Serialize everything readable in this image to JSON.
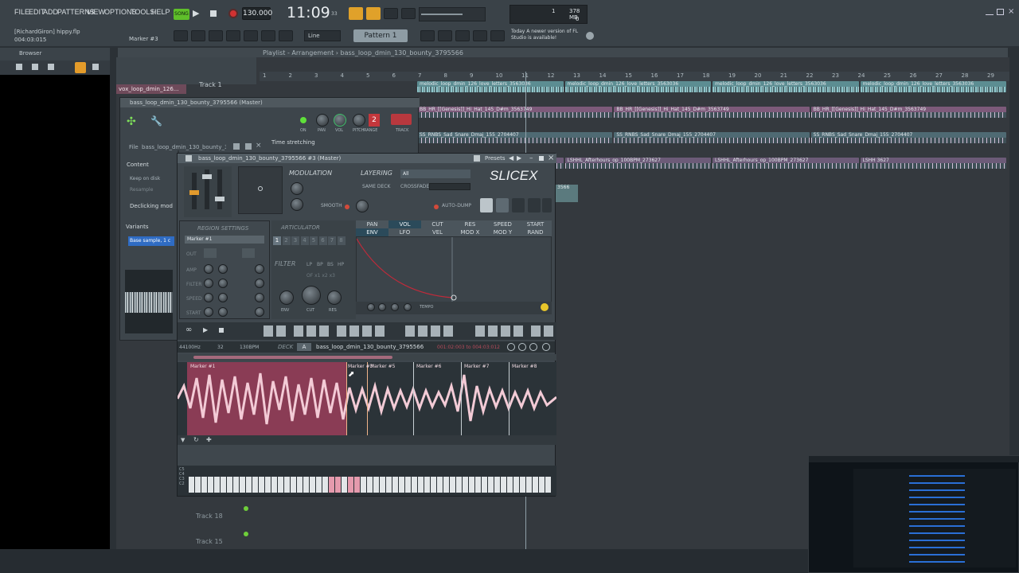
{
  "menu": [
    "FILE",
    "EDIT",
    "ADD",
    "PATTERNS",
    "VIEW",
    "OPTIONS",
    "TOOLS",
    "HELP"
  ],
  "transport": {
    "song_label": "SONG",
    "tempo": "130.000",
    "clock": "11:09",
    "clock_sub": "33",
    "cpu": "1",
    "memory": "378 MB",
    "poly": "0"
  },
  "project": {
    "user": "[RichardGiron] hippy.flp",
    "time": "004:03:015",
    "marker": "Marker #3"
  },
  "toolbar": {
    "snap": "Line",
    "pattern": "Pattern 1",
    "news": "Today  A newer version of FL Studio is available!"
  },
  "browser": {
    "label": "Browser"
  },
  "playlist": {
    "breadcrumb": "Playlist - Arrangement › bass_loop_dmin_130_bounty_3795566",
    "bar_numbers": [
      "1",
      "2",
      "3",
      "4",
      "5",
      "6",
      "7",
      "8",
      "9",
      "10",
      "11",
      "12",
      "13",
      "14",
      "15",
      "16",
      "17",
      "18",
      "19",
      "20",
      "21",
      "22",
      "23",
      "24",
      "25",
      "26",
      "27",
      "28",
      "29"
    ],
    "track_label": "Track 1",
    "pattern_tab": "vox_loop_dmin_126...",
    "rows": [
      {
        "clips": [
          "melodic_loop_dmin_126_love_letters_3563036",
          "melodic_loop_dmin_126_love_letters_3563036",
          "melodic_loop_dmin_126_love_letters_3563036",
          "melodic_loop_dmin_126_love_letters_3563036"
        ],
        "color": "#5c8d92",
        "wave": "wave"
      },
      {
        "clips": [
          "BB_HR_[[Genesis]]_Hi_Hat_145_D#m_3563749",
          "BB_HR_[[Genesis]]_Hi_Hat_145_D#m_3563749",
          "BB_HR_[[Genesis]]_Hi_Hat_145_D#m_3563749"
        ],
        "color": "#7d5a7a",
        "wave": "wave2"
      },
      {
        "clips": [
          "SS_RNBS_Sad_Snare_Dmaj_155_2704407",
          "SS_RNBS_Sad_Snare_Dmaj_155_2704407",
          "SS_RNBS_Sad_Snare_Dmaj_155_2704407"
        ],
        "color": "#4f6a73",
        "wave": "wave2"
      },
      {
        "clips": [
          "LSHHL_Afterhours_op_100BPM_273627",
          "LSHHL_Afterhours_op_100BPM_273627",
          "LSHHL_Afterhours_op_100BPM_273627",
          "LSHH 3627"
        ],
        "color": "#6c5b78",
        "wave": "wave2"
      }
    ],
    "small_clip": "3566",
    "bottom_tracks": [
      "Track 18",
      "Track 15"
    ]
  },
  "channel": {
    "title": "bass_loop_dmin_130_bounty_3795566 (Master)",
    "file_label": "File",
    "file_name": "bass_loop_dmin_130_bounty_3795566.wav",
    "time_stretch": "Time stretching",
    "content": "Content",
    "keep_on_disk": "Keep on disk",
    "resample": "Resample",
    "declicking": "Declicking mod",
    "variants": "Variants",
    "variant_value": "Base sample, 1 c",
    "track_num": "2",
    "labels": [
      "ON",
      "PAN",
      "VOL",
      "PITCH",
      "RANGE",
      "TRACK"
    ]
  },
  "slicex": {
    "title": "bass_loop_dmin_130_bounty_3795566 #3 (Master)",
    "presets": "Presets",
    "logo": "SLICEX",
    "modulation": "MODULATION",
    "layering": "LAYERING",
    "layer_sel": "All",
    "same_deck": "SAME DECK",
    "crossfade": "CROSSFADE",
    "auto_dump": "AUTO-DUMP",
    "smooth": "SMOOTH",
    "region_settings": "REGION SETTINGS",
    "articulator": "ARTICULATOR",
    "marker_sel": "Marker #1",
    "art_nums": [
      "1",
      "2",
      "3",
      "4",
      "5",
      "6",
      "7",
      "8"
    ],
    "tabs_row1": [
      "PAN",
      "VOL",
      "CUT",
      "RES",
      "SPEED",
      "START"
    ],
    "tabs_row2": [
      "ENV",
      "LFO",
      "VEL",
      "MOD X",
      "MOD Y",
      "RAND"
    ],
    "selected_tab": "VOL",
    "filter": "FILTER",
    "filter_types": [
      "LP",
      "BP",
      "BS",
      "HP"
    ],
    "filter_off": "OF  x1  x2  x3",
    "region_rows": [
      "OUT",
      "AMP",
      "FILTER",
      "SPEED",
      "START"
    ],
    "knob_labels": [
      "ENV",
      "CUT",
      "RES"
    ],
    "tempo": "TEMPO",
    "samplerate": "44100Hz",
    "bpm": "130BPM",
    "beats": "32",
    "deck": "DECK",
    "deck_name": "bass_loop_dmin_130_bounty_3795566",
    "range": "001:02:003 to 004:03:012",
    "markers": [
      "Marker #1",
      "Marker #3",
      "Marker #5",
      "Marker #6",
      "Marker #7",
      "Marker #8"
    ],
    "ruler": [
      "1",
      "2",
      "3",
      "4"
    ]
  }
}
